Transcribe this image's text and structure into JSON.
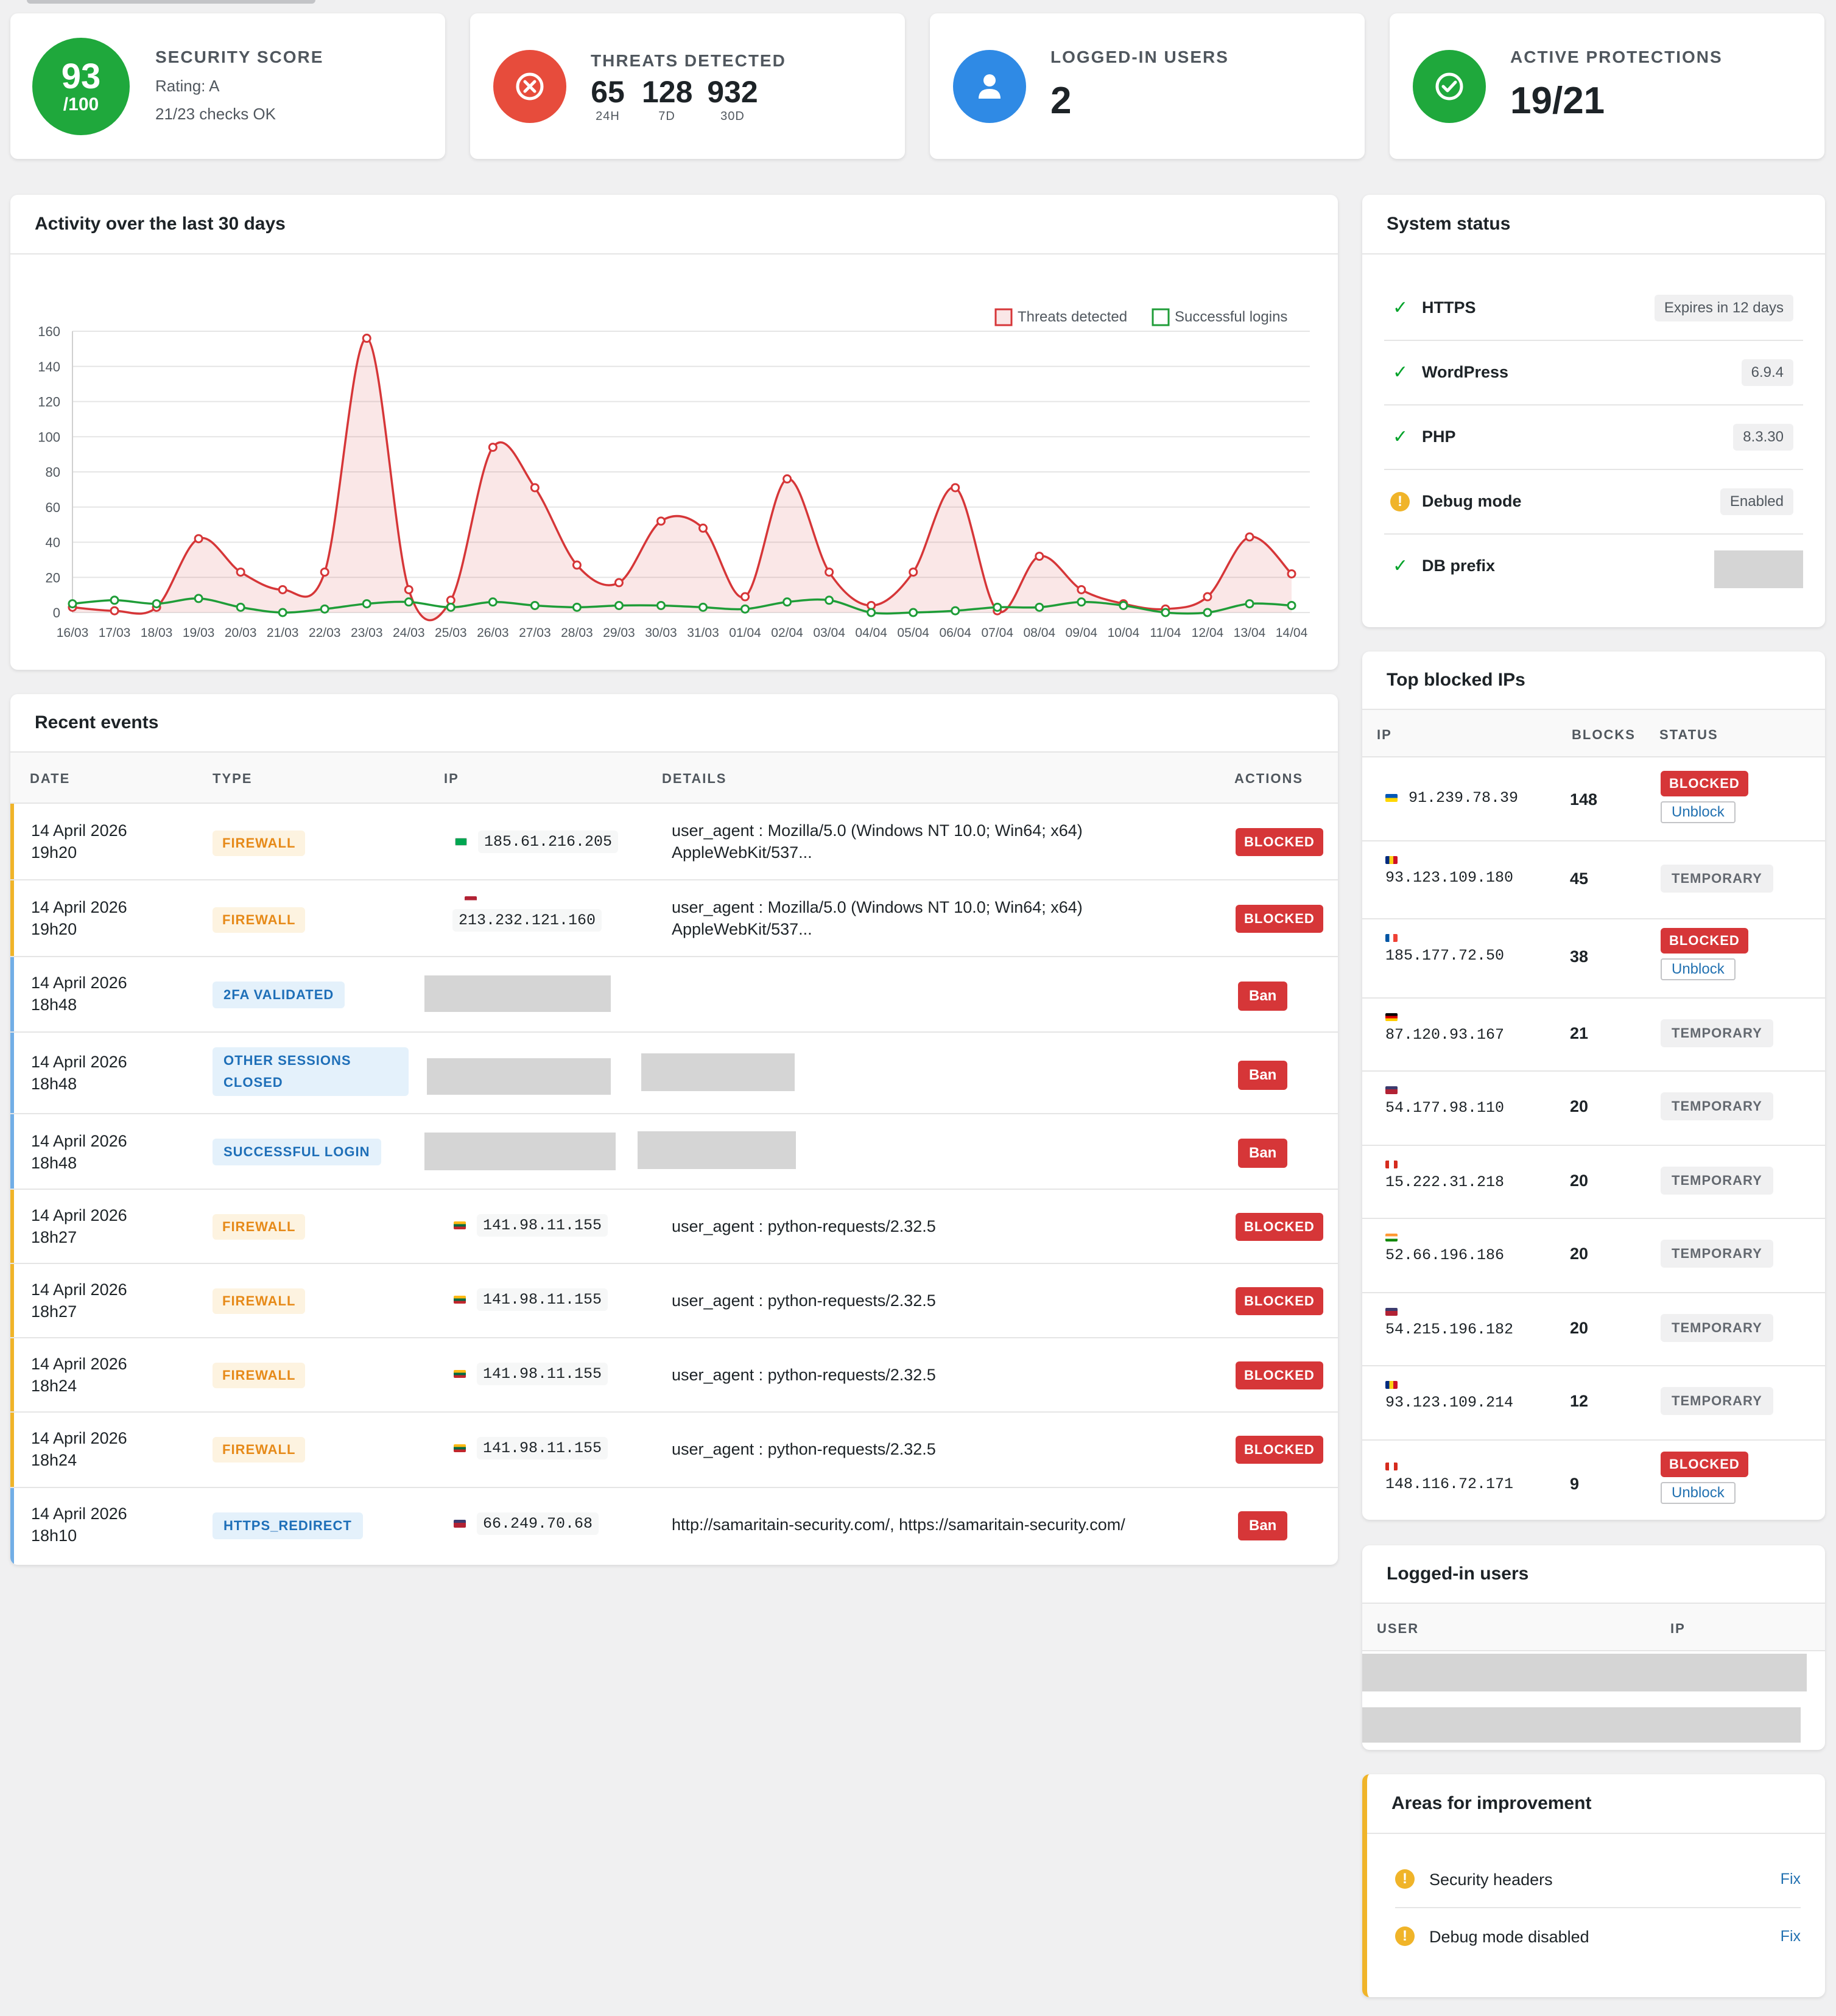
{
  "stats": {
    "score": {
      "label": "SECURITY SCORE",
      "value": "93",
      "denominator": "/100",
      "rating": "Rating: A",
      "checks": "21/23 checks OK",
      "color": "#1fa83c"
    },
    "threats": {
      "label": "THREATS DETECTED",
      "icon": "x-circle-icon",
      "color": "#e74c3c",
      "values": [
        {
          "n": "65",
          "u": "24H"
        },
        {
          "n": "128",
          "u": "7D"
        },
        {
          "n": "932",
          "u": "30D"
        }
      ]
    },
    "users": {
      "label": "LOGGED-IN USERS",
      "value": "2",
      "icon": "user-icon",
      "color": "#2f8ae5"
    },
    "protections": {
      "label": "ACTIVE PROTECTIONS",
      "value": "19/21",
      "icon": "check-circle-icon",
      "color": "#1fa83c"
    }
  },
  "activity": {
    "title": "Activity over the last 30 days"
  },
  "chart_data": {
    "type": "line",
    "title": "Activity over the last 30 days",
    "x": [
      "16/03",
      "17/03",
      "18/03",
      "19/03",
      "20/03",
      "21/03",
      "22/03",
      "23/03",
      "24/03",
      "25/03",
      "26/03",
      "27/03",
      "28/03",
      "29/03",
      "30/03",
      "31/03",
      "01/04",
      "02/04",
      "03/04",
      "04/04",
      "05/04",
      "06/04",
      "07/04",
      "08/04",
      "09/04",
      "10/04",
      "11/04",
      "12/04",
      "13/04",
      "14/04"
    ],
    "ylim": [
      0,
      160
    ],
    "yticks": [
      0,
      20,
      40,
      60,
      80,
      100,
      120,
      140,
      160
    ],
    "grid": true,
    "legend": "top-right",
    "series": [
      {
        "name": "Threats detected",
        "color": "#d63638",
        "fill": true,
        "values": [
          3,
          1,
          3,
          42,
          23,
          13,
          23,
          156,
          13,
          7,
          94,
          71,
          27,
          17,
          52,
          48,
          9,
          76,
          23,
          4,
          23,
          71,
          1,
          32,
          13,
          5,
          2,
          9,
          43,
          22
        ]
      },
      {
        "name": "Successful logins",
        "color": "#1f9d38",
        "fill": false,
        "values": [
          5,
          7,
          5,
          8,
          3,
          0,
          2,
          5,
          6,
          3,
          6,
          4,
          3,
          4,
          4,
          3,
          2,
          6,
          7,
          0,
          0,
          1,
          3,
          3,
          6,
          4,
          0,
          0,
          5,
          4
        ]
      }
    ]
  },
  "events": {
    "title": "Recent events",
    "headers": {
      "date": "DATE",
      "type": "TYPE",
      "ip": "IP",
      "details": "DETAILS",
      "actions": "ACTIONS"
    },
    "rows": [
      {
        "date1": "14 April 2026",
        "date2": "19h20",
        "type": "FIREWALL",
        "ip": "185.61.216.205",
        "details1": "user_agent : Mozilla/5.0 (Windows NT 10.0; Win64; x64)",
        "details2": "AppleWebKit/537...",
        "action": "BLOCKED"
      },
      {
        "date1": "14 April 2026",
        "date2": "19h20",
        "type": "FIREWALL",
        "ip": "213.232.121.160",
        "details1": "user_agent : Mozilla/5.0 (Windows NT 10.0; Win64; x64)",
        "details2": "AppleWebKit/537...",
        "action": "BLOCKED"
      },
      {
        "date1": "14 April 2026",
        "date2": "18h48",
        "type": "2FA VALIDATED",
        "action": "Ban"
      },
      {
        "date1": "14 April 2026",
        "date2": "18h48",
        "type1": "OTHER SESSIONS",
        "type2": "CLOSED",
        "action": "Ban"
      },
      {
        "date1": "14 April 2026",
        "date2": "18h48",
        "type": "SUCCESSFUL LOGIN",
        "action": "Ban"
      },
      {
        "date1": "14 April 2026",
        "date2": "18h27",
        "type": "FIREWALL",
        "ip": "141.98.11.155",
        "details1": "user_agent : python-requests/2.32.5",
        "action": "BLOCKED"
      },
      {
        "date1": "14 April 2026",
        "date2": "18h27",
        "type": "FIREWALL",
        "ip": "141.98.11.155",
        "details1": "user_agent : python-requests/2.32.5",
        "action": "BLOCKED"
      },
      {
        "date1": "14 April 2026",
        "date2": "18h24",
        "type": "FIREWALL",
        "ip": "141.98.11.155",
        "details1": "user_agent : python-requests/2.32.5",
        "action": "BLOCKED"
      },
      {
        "date1": "14 April 2026",
        "date2": "18h24",
        "type": "FIREWALL",
        "ip": "141.98.11.155",
        "details1": "user_agent : python-requests/2.32.5",
        "action": "BLOCKED"
      },
      {
        "date1": "14 April 2026",
        "date2": "18h10",
        "type": "HTTPS_REDIRECT",
        "ip": "66.249.70.68",
        "details1": "http://samaritain-security.com/, https://samaritain-security.com/",
        "action": "Ban"
      }
    ]
  },
  "system": {
    "title": "System status",
    "items": [
      {
        "name": "HTTPS",
        "value": "Expires in 12 days",
        "status": "ok"
      },
      {
        "name": "WordPress",
        "value": "6.9.4",
        "status": "ok"
      },
      {
        "name": "PHP",
        "value": "8.3.30",
        "status": "ok"
      },
      {
        "name": "Debug mode",
        "value": "Enabled",
        "status": "warn"
      },
      {
        "name": "DB prefix",
        "value": "",
        "status": "ok"
      }
    ]
  },
  "blocked": {
    "title": "Top blocked IPs",
    "headers": {
      "ip": "IP",
      "blocks": "BLOCKS",
      "status": "STATUS"
    },
    "unblock_label": "Unblock",
    "rows": [
      {
        "ip": "91.239.78.39",
        "blocks": "148",
        "status": "BLOCKED"
      },
      {
        "ip": "93.123.109.180",
        "blocks": "45",
        "status": "TEMPORARY"
      },
      {
        "ip": "185.177.72.50",
        "blocks": "38",
        "status": "BLOCKED"
      },
      {
        "ip": "87.120.93.167",
        "blocks": "21",
        "status": "TEMPORARY"
      },
      {
        "ip": "54.177.98.110",
        "blocks": "20",
        "status": "TEMPORARY"
      },
      {
        "ip": "15.222.31.218",
        "blocks": "20",
        "status": "TEMPORARY"
      },
      {
        "ip": "52.66.196.186",
        "blocks": "20",
        "status": "TEMPORARY"
      },
      {
        "ip": "54.215.196.182",
        "blocks": "20",
        "status": "TEMPORARY"
      },
      {
        "ip": "93.123.109.214",
        "blocks": "12",
        "status": "TEMPORARY"
      },
      {
        "ip": "148.116.72.171",
        "blocks": "9",
        "status": "BLOCKED"
      }
    ]
  },
  "logged": {
    "title": "Logged-in users",
    "headers": {
      "user": "USER",
      "ip": "IP"
    }
  },
  "improve": {
    "title": "Areas for improvement",
    "fix_label": "Fix",
    "items": [
      {
        "name": "Security headers"
      },
      {
        "name": "Debug mode disabled"
      }
    ]
  }
}
